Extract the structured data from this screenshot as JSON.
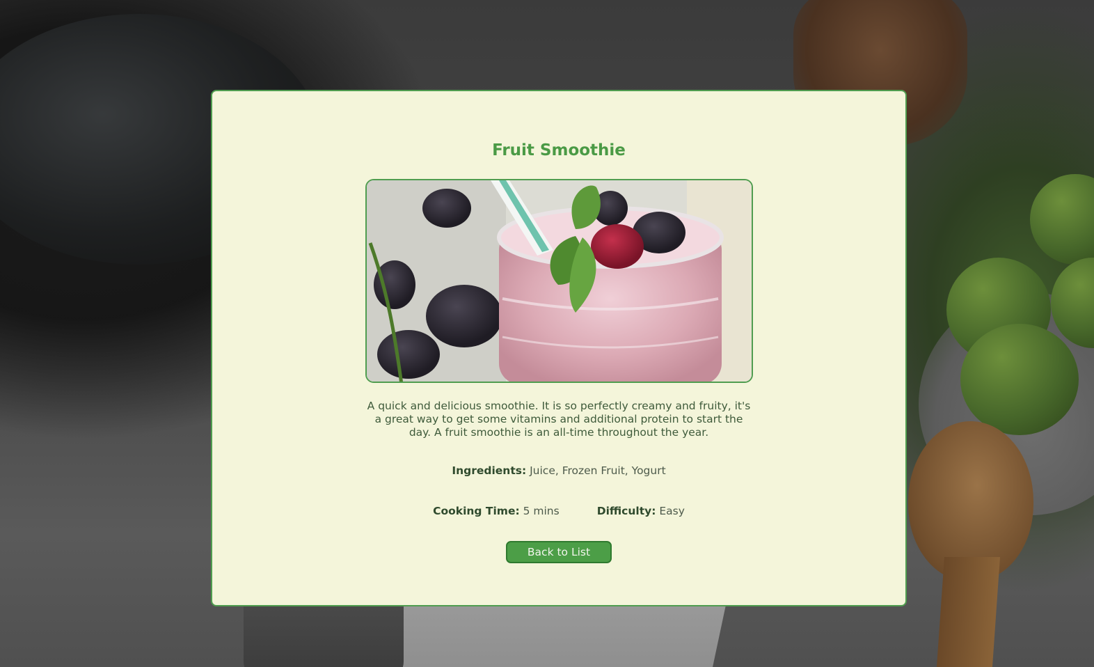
{
  "recipe": {
    "title": "Fruit Smoothie",
    "image_alt": "Fruit Smoothie",
    "description": "A quick and delicious smoothie. It is so perfectly creamy and fruity, it's a great way to get some vitamins and additional protein to start the day. A fruit smoothie is an all-time throughout the year.",
    "ingredients_label": "Ingredients:",
    "ingredients": "Juice, Frozen Fruit, Yogurt",
    "cooking_time_label": "Cooking Time:",
    "cooking_time": "5 mins",
    "difficulty_label": "Difficulty:",
    "difficulty": "Easy"
  },
  "actions": {
    "back_label": "Back to List"
  },
  "colors": {
    "accent": "#4c9e47",
    "modal_bg": "#f4f5da",
    "title": "#4a9a45"
  }
}
